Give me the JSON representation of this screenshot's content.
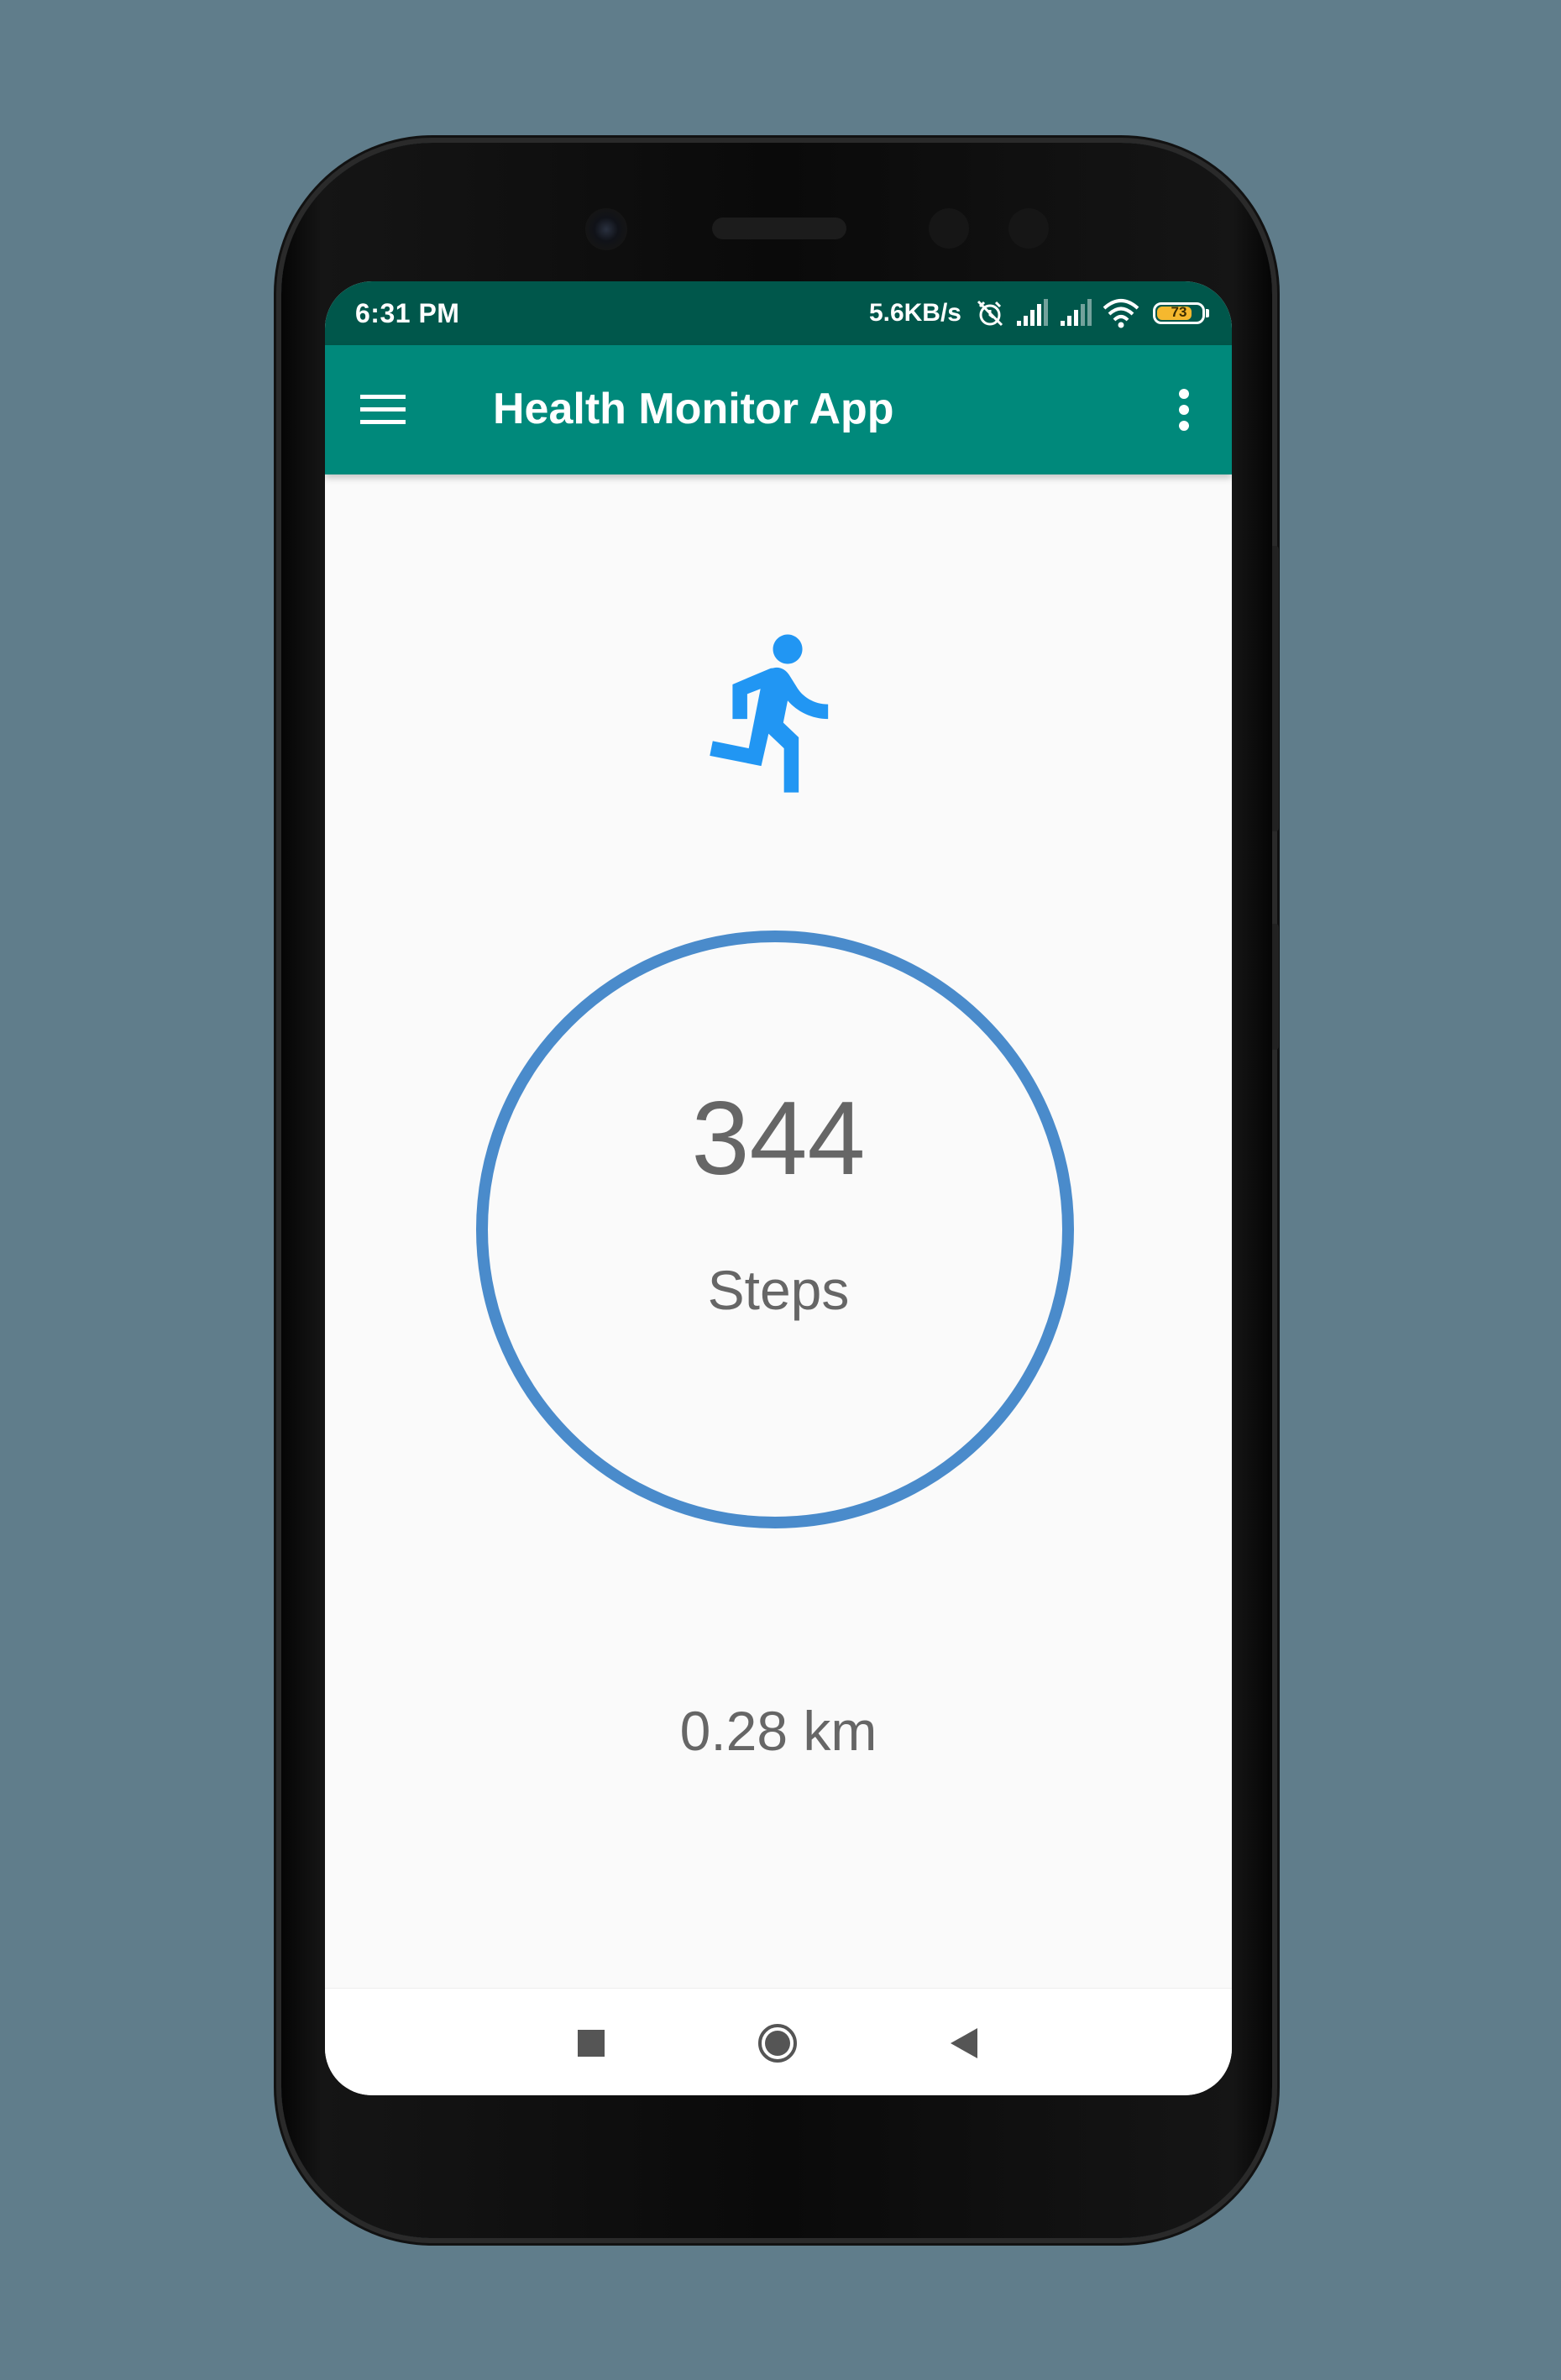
{
  "status_bar": {
    "time": "6:31 PM",
    "network_speed": "5.6KB/s",
    "battery_level": "73",
    "icons": [
      "alarm-off-icon",
      "signal-icon",
      "signal-icon",
      "wifi-icon",
      "battery-icon"
    ]
  },
  "app_bar": {
    "title": "Health Monitor App",
    "menu_icon": "hamburger-menu-icon",
    "overflow_icon": "more-vert-icon"
  },
  "main": {
    "activity_icon": "directions-run-icon",
    "steps_value": "344",
    "steps_label": "Steps",
    "distance": "0.28 km"
  },
  "nav_bar": {
    "buttons": [
      "recent-apps-icon",
      "home-icon",
      "back-icon"
    ]
  },
  "colors": {
    "background": "#607d8b",
    "status_bar": "#00574b",
    "app_bar": "#00897b",
    "accent_blue": "#2196f3",
    "ring": "#4a8bcb",
    "text_gray": "#666666",
    "battery": "#f5b82e"
  }
}
